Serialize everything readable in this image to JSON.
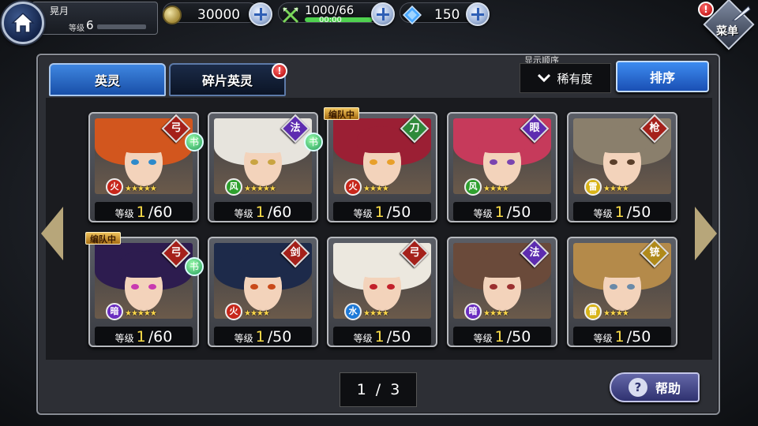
{
  "player": {
    "name": "晃月",
    "level_label": "等级",
    "level_value": "6"
  },
  "resources": {
    "coins": "30000",
    "stamina": "1000/66",
    "stamina_timer": "00:00",
    "gems": "150"
  },
  "menu": {
    "label": "菜单",
    "alert": "!"
  },
  "tabs": [
    {
      "label": "英灵",
      "active": true
    },
    {
      "label": "碎片英灵",
      "active": false,
      "alert": "!"
    }
  ],
  "sort": {
    "caption": "显示顺序",
    "selected": "稀有度",
    "button_label": "排序"
  },
  "level_label": "等级",
  "party_tag": "编队中",
  "heroes": [
    {
      "level": "1",
      "max_level": "/60",
      "element": "fire",
      "class_icon": "bow-icon",
      "has_book": true,
      "stars": 5,
      "in_party": false,
      "hair": "#d2561e",
      "eye": "#2d8acb"
    },
    {
      "level": "1",
      "max_level": "/60",
      "element": "wind",
      "class_icon": "hat-icon",
      "has_book": true,
      "stars": 5,
      "in_party": false,
      "hair": "#e7e4dd",
      "eye": "#c9a441"
    },
    {
      "level": "1",
      "max_level": "/50",
      "element": "fire",
      "class_icon": "sword-icon",
      "has_book": false,
      "stars": 4,
      "in_party": true,
      "hair": "#9b1f34",
      "eye": "#e8a02a"
    },
    {
      "level": "1",
      "max_level": "/50",
      "element": "wind",
      "class_icon": "eye-icon",
      "has_book": false,
      "stars": 4,
      "in_party": false,
      "hair": "#c63a5b",
      "eye": "#7a44b0"
    },
    {
      "level": "1",
      "max_level": "/50",
      "element": "thunder",
      "class_icon": "lance-icon",
      "has_book": false,
      "stars": 4,
      "in_party": false,
      "hair": "#8a7f6c",
      "eye": "#5a3f2a"
    },
    {
      "level": "1",
      "max_level": "/60",
      "element": "dark",
      "class_icon": "bow-icon",
      "has_book": true,
      "stars": 5,
      "in_party": true,
      "hair": "#2d1c4f",
      "eye": "#c83ab0"
    },
    {
      "level": "1",
      "max_level": "/50",
      "element": "fire",
      "class_icon": "swords-icon",
      "has_book": false,
      "stars": 4,
      "in_party": false,
      "hair": "#1d2a4a",
      "eye": "#c94a1a"
    },
    {
      "level": "1",
      "max_level": "/50",
      "element": "water",
      "class_icon": "bow-icon",
      "has_book": false,
      "stars": 4,
      "in_party": false,
      "hair": "#ece8df",
      "eye": "#c2202a"
    },
    {
      "level": "1",
      "max_level": "/50",
      "element": "dark",
      "class_icon": "hat-icon",
      "has_book": false,
      "stars": 4,
      "in_party": false,
      "hair": "#6a4a3a",
      "eye": "#9b3030"
    },
    {
      "level": "1",
      "max_level": "/50",
      "element": "thunder",
      "class_icon": "gun-icon",
      "has_book": false,
      "stars": 4,
      "in_party": false,
      "hair": "#b48a4a",
      "eye": "#6a8aa8"
    }
  ],
  "pager": {
    "current": "1",
    "separator": "/",
    "total": "3"
  },
  "help": {
    "label": "帮助",
    "icon": "?"
  },
  "colors": {
    "fire": "#c7271b",
    "wind": "#2fa02f",
    "thunder": "#d8b419",
    "dark": "#6a2dbf",
    "water": "#1e7ad8",
    "class_red": "#a5201a",
    "class_purple": "#5d2cb0",
    "class_green": "#2f8a3a",
    "class_gold": "#b08a1a"
  }
}
